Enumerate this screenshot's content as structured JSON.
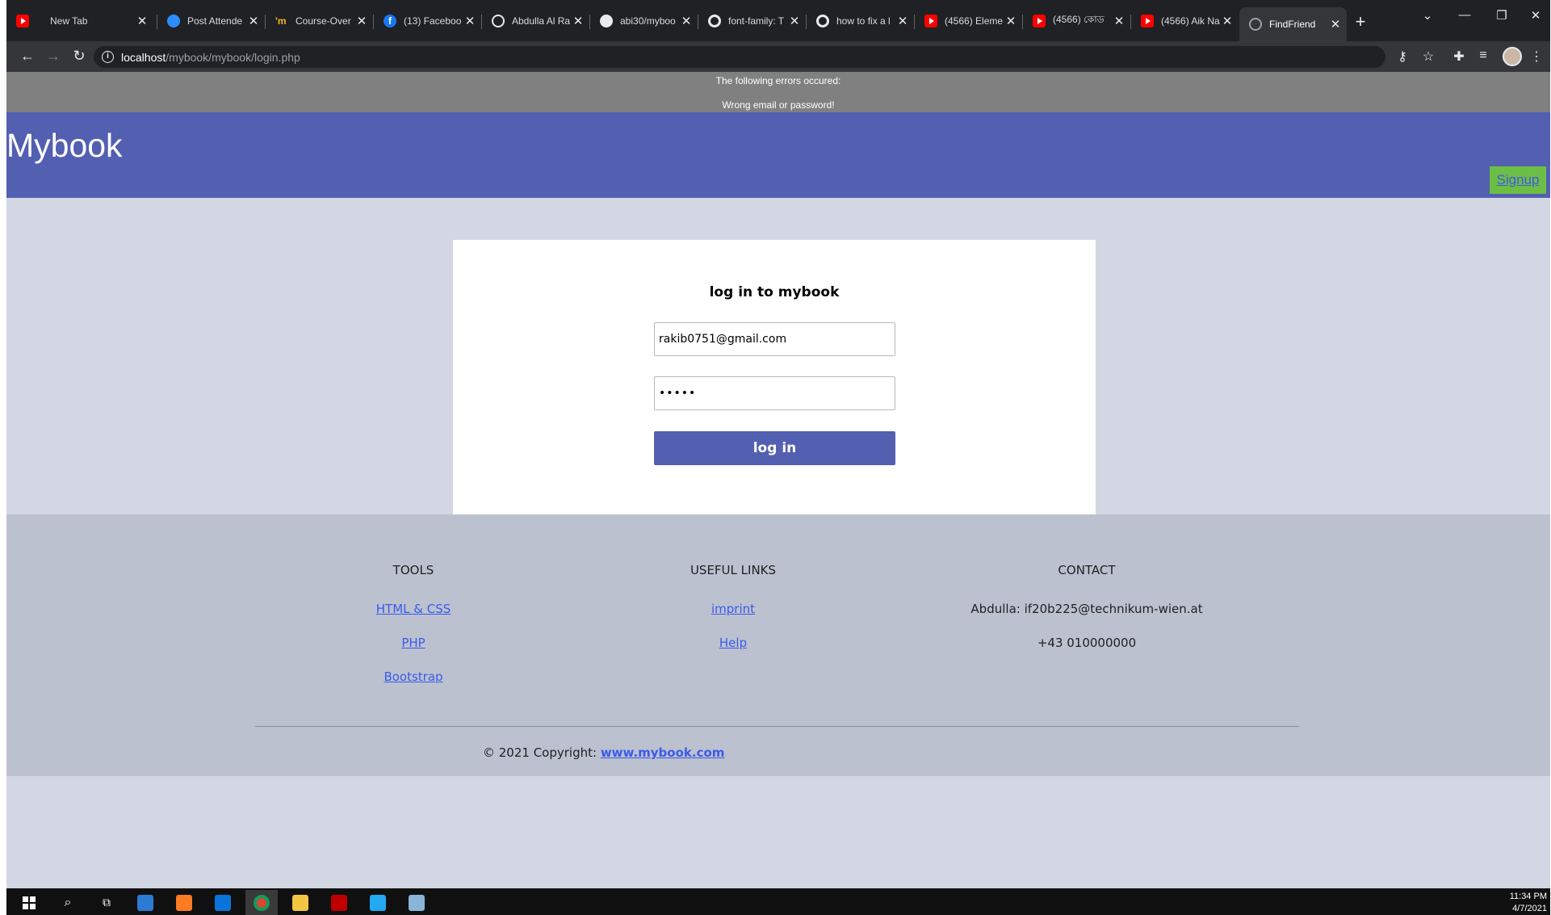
{
  "browser": {
    "tabs": [
      {
        "label": "",
        "icon": "youtube-icon"
      },
      {
        "label": "New Tab",
        "icon": "none"
      },
      {
        "label": "Post Attende",
        "icon": "zoom-icon"
      },
      {
        "label": "Course-Over",
        "icon": "imc-icon"
      },
      {
        "label": "(13) Faceboo",
        "icon": "facebook-icon"
      },
      {
        "label": "Abdulla Al Ra",
        "icon": "wordpress-icon"
      },
      {
        "label": "abi30/myboo",
        "icon": "github-icon"
      },
      {
        "label": "font-family: T",
        "icon": "google-icon"
      },
      {
        "label": "how to fix a l",
        "icon": "google-icon"
      },
      {
        "label": "(4566) Eleme",
        "icon": "youtube-icon"
      },
      {
        "label": "(4566) কোড",
        "icon": "youtube-icon"
      },
      {
        "label": "(4566) Aik Na",
        "icon": "youtube-icon"
      },
      {
        "label": "FindFriend",
        "icon": "globe-icon",
        "active": true
      }
    ],
    "url_host": "localhost",
    "url_path": "/mybook/mybook/login.php"
  },
  "error": {
    "title": "The following errors occured:",
    "message": "Wrong email or password!"
  },
  "header": {
    "logo": "Mybook",
    "signup_label": "Signup"
  },
  "login": {
    "title": "log in to mybook",
    "email_value": "rakib0751@gmail.com",
    "password_value": "•••••",
    "button_label": "log in"
  },
  "footer": {
    "tools": {
      "heading": "TOOLS",
      "links": [
        "HTML & CSS",
        "PHP",
        "Bootstrap"
      ]
    },
    "useful_links": {
      "heading": "USEFUL LINKS",
      "links": [
        "imprint",
        "Help"
      ]
    },
    "contact": {
      "heading": "CONTACT",
      "email_line": "Abdulla: if20b225@technikum-wien.at",
      "phone": "+43 010000000"
    },
    "copyright_prefix": "© 2021 Copyright: ",
    "copyright_link": "www.mybook.com"
  },
  "taskbar": {
    "time": "11:34 PM",
    "date": "4/7/2021"
  },
  "colors": {
    "header": "#535fb0",
    "page_bg": "#d3d7e3",
    "footer_bg": "#bcc1d0",
    "error_bg": "#808080",
    "signup_bg": "#6dbe45",
    "link": "#3b5be8"
  }
}
